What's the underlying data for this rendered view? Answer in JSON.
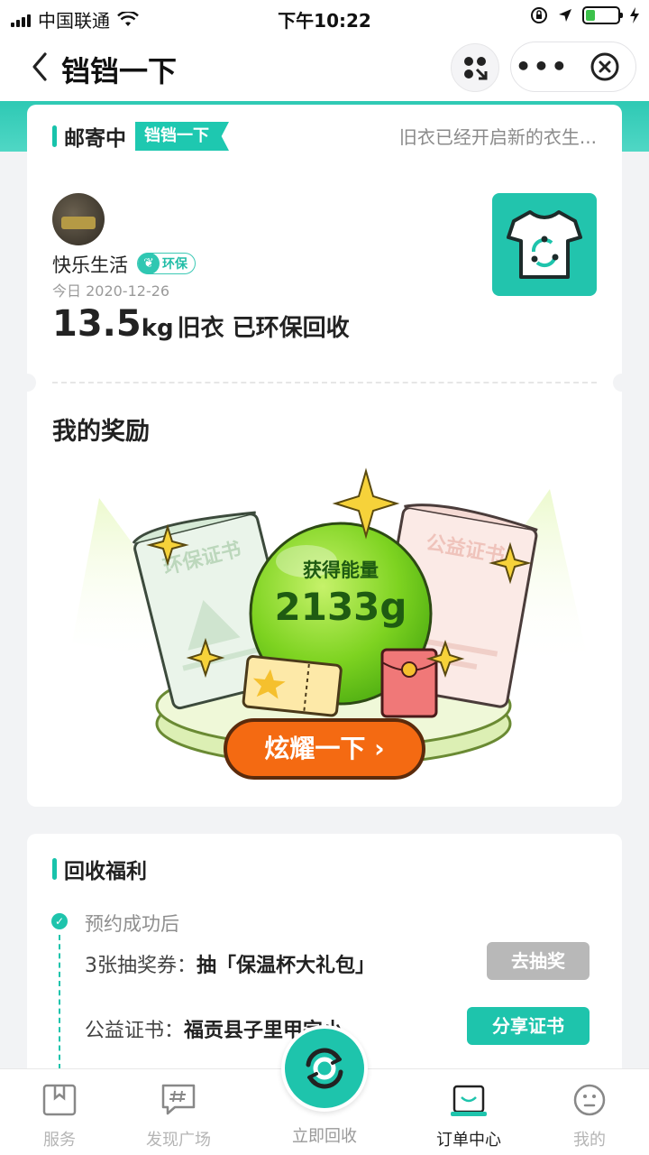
{
  "status_bar": {
    "carrier": "中国联通",
    "time": "下午10:22"
  },
  "nav": {
    "title": "铛铛一下",
    "more_label": "•••"
  },
  "order_card": {
    "section_title": "邮寄中",
    "brand_tag": "铛铛一下",
    "header_note": "旧衣已经开启新的衣生...",
    "user_name": "快乐生活",
    "eco_badge": "环保",
    "date": "今日 2020-12-26",
    "weight_value": "13.5",
    "weight_unit": "kg",
    "weight_desc": "旧衣 已环保回收",
    "rewards_title": "我的奖励",
    "eco_cert_text": "环保证书",
    "charity_cert_text": "公益证书",
    "energy_label": "获得能量",
    "energy_value": "2133g",
    "show_button": "炫耀一下 ›"
  },
  "benefit_card": {
    "section_title": "回收福利",
    "step_label": "预约成功后",
    "rows": [
      {
        "label": "3张抽奖券：",
        "value": "抽「保温杯大礼包」",
        "button": "去抽奖"
      },
      {
        "label": "公益证书：",
        "value": "福贡县子里甲完小",
        "button": "分享证书"
      }
    ]
  },
  "tab_bar": {
    "tabs": [
      {
        "label": "服务",
        "icon": "bookmark-icon"
      },
      {
        "label": "发现广场",
        "icon": "hashtag-chat-icon"
      },
      {
        "label": "立即回收",
        "icon": "recycle-icon"
      },
      {
        "label": "订单中心",
        "icon": "order-box-icon"
      },
      {
        "label": "我的",
        "icon": "face-icon"
      }
    ],
    "active_tab": "订单中心"
  },
  "colors": {
    "accent": "#1ec4ac",
    "button_orange": "#f46a12",
    "energy_green": "#7ed321"
  }
}
